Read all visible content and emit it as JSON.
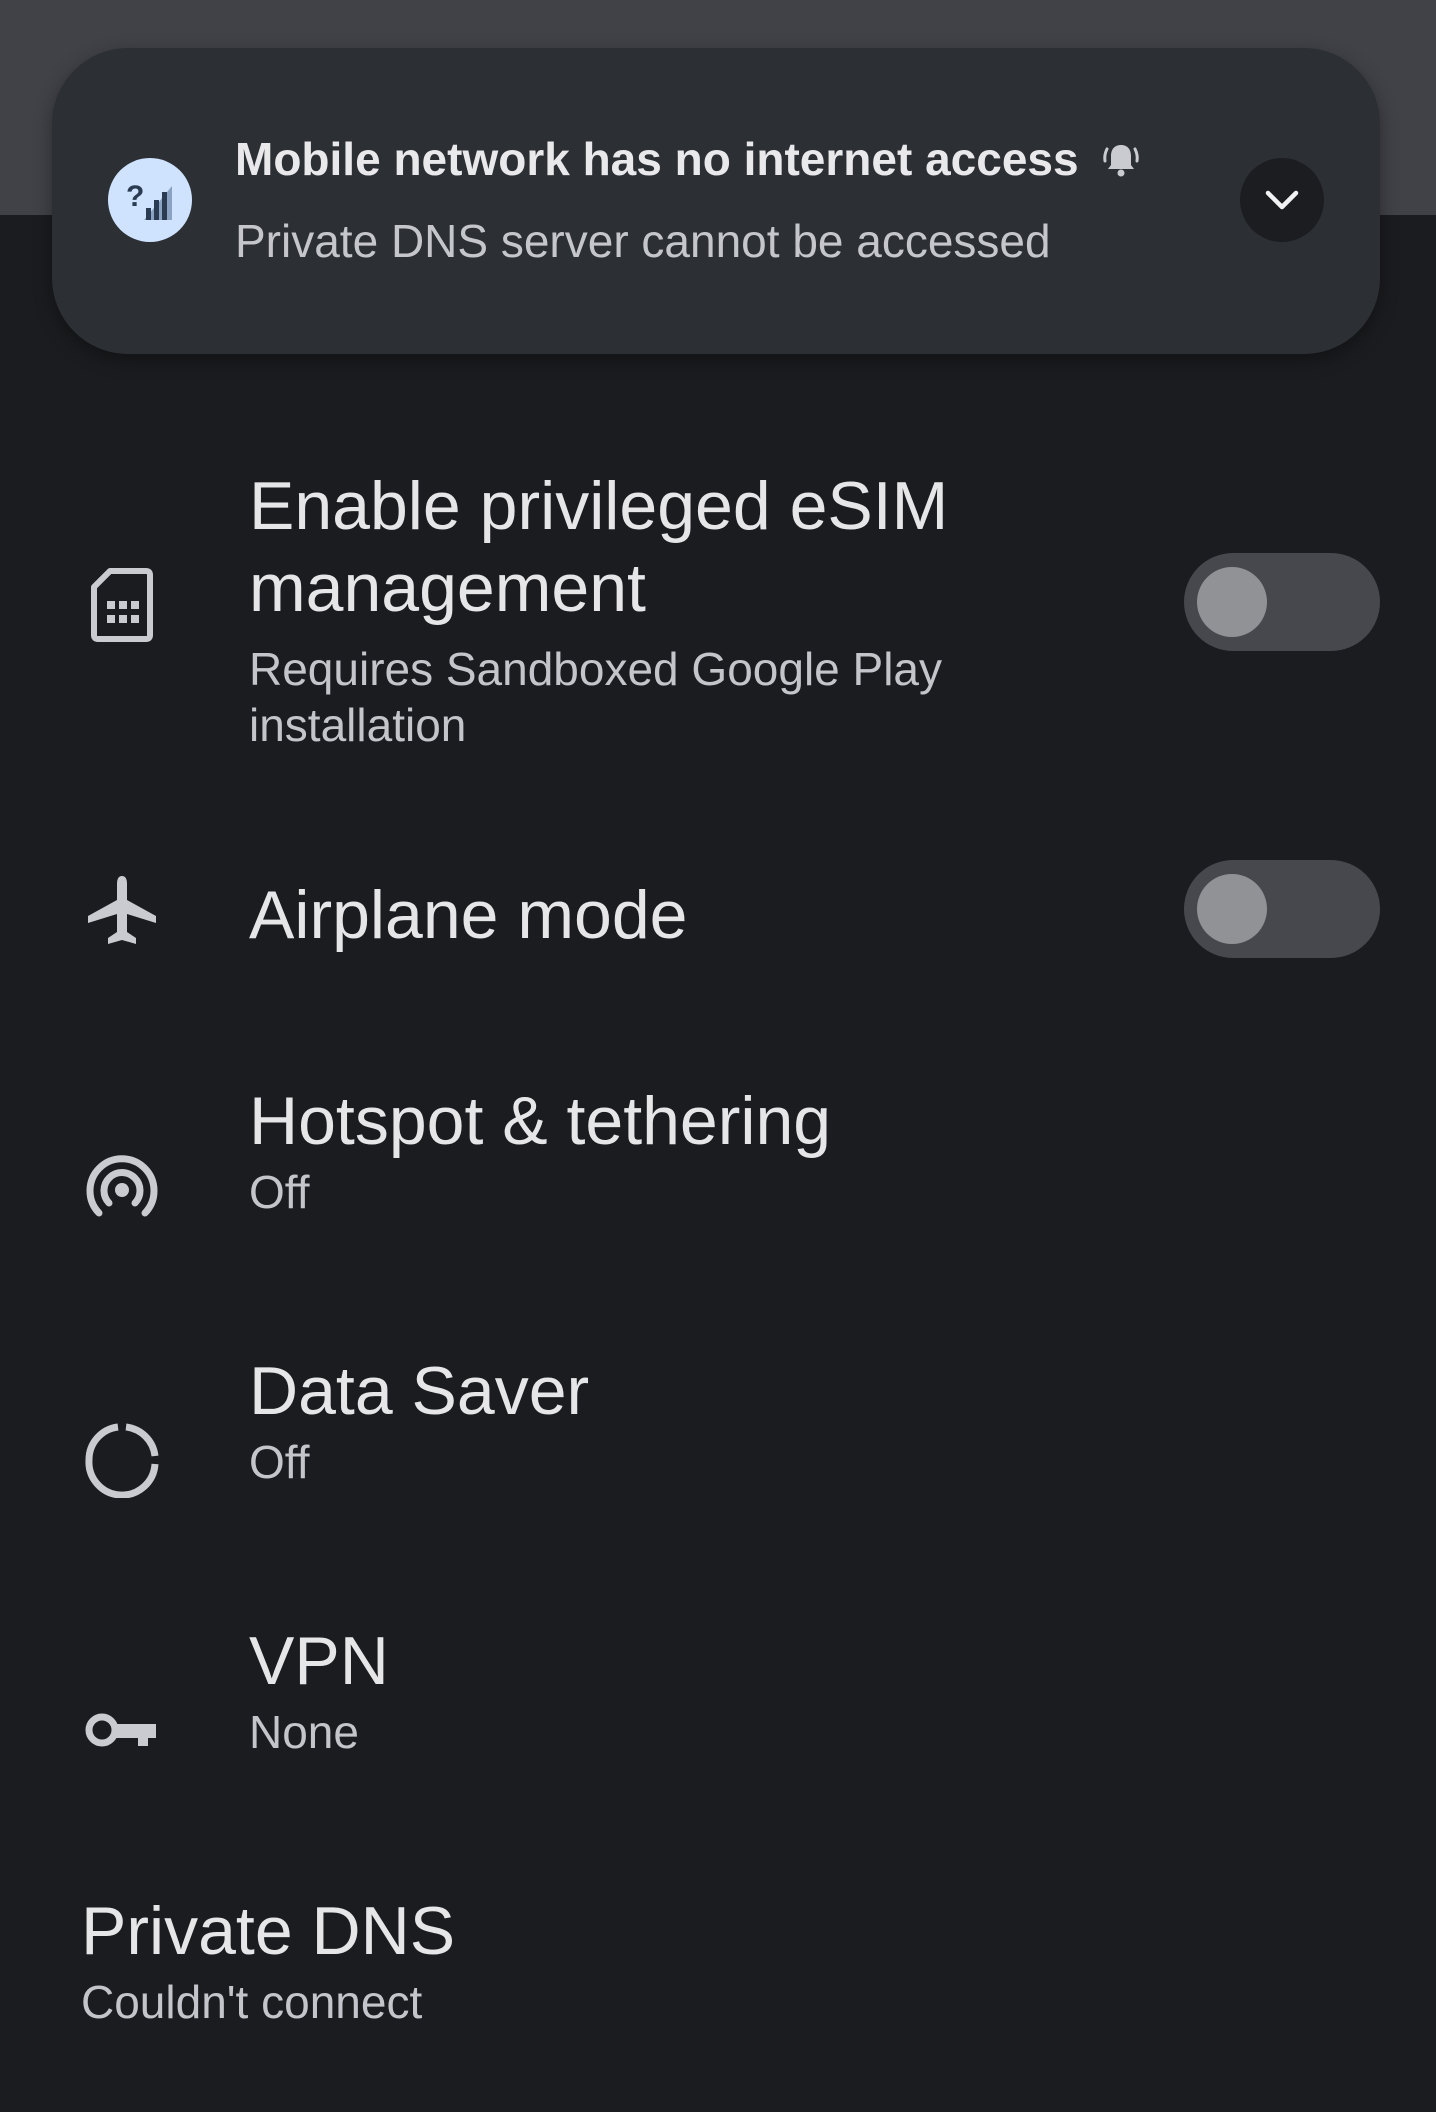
{
  "notification": {
    "title": "Mobile network has no internet access",
    "subtitle": "Private DNS server cannot be accessed",
    "icon": "signal-question-icon",
    "expand_icon": "chevron-down-icon"
  },
  "settings": {
    "esim": {
      "title_line1": "Enable privileged eSIM",
      "title_line2": "management",
      "summary_line1": "Requires Sandboxed Google Play",
      "summary_line2": "installation",
      "toggle_on": false,
      "icon": "sim-card-icon"
    },
    "airplane": {
      "title": "Airplane mode",
      "toggle_on": false,
      "icon": "airplane-icon"
    },
    "hotspot": {
      "title": "Hotspot & tethering",
      "summary": "Off",
      "icon": "hotspot-icon"
    },
    "data_saver": {
      "title": "Data Saver",
      "summary": "Off",
      "icon": "data-saver-icon"
    },
    "vpn": {
      "title": "VPN",
      "summary": "None",
      "icon": "key-icon"
    },
    "private_dns": {
      "title": "Private DNS",
      "summary": "Couldn't connect"
    }
  },
  "colors": {
    "background": "#1a1c1f",
    "notification_bg": "#2c2f34",
    "toggle_off_track": "#46484d",
    "toggle_off_thumb": "#909296",
    "accent_icon_bg": "#cfe3ff"
  }
}
